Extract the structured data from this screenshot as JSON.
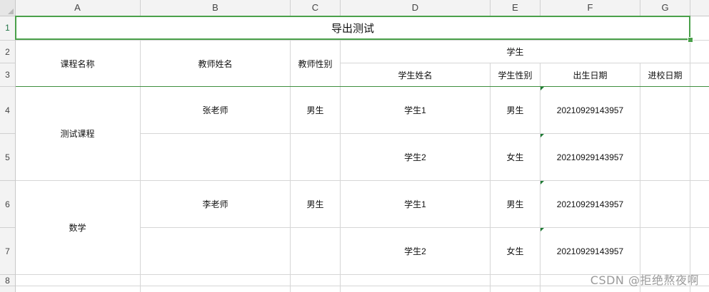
{
  "sheet": {
    "title": "导出测试",
    "columns": [
      "A",
      "B",
      "C",
      "D",
      "E",
      "F",
      "G"
    ],
    "rows": [
      "1",
      "2",
      "3",
      "4",
      "5",
      "6",
      "7",
      "8"
    ],
    "header": {
      "course_name": "课程名称",
      "teacher_name": "教师姓名",
      "teacher_gender": "教师性别",
      "student_group": "学生",
      "student_name": "学生姓名",
      "student_gender": "学生性别",
      "birth_date": "出生日期",
      "enroll_date": "进校日期"
    },
    "data": [
      {
        "course": "测试课程",
        "teacher": "张老师",
        "teacher_gender": "男生",
        "students": [
          {
            "name": "学生1",
            "gender": "男生",
            "birth": "20210929143957"
          },
          {
            "name": "学生2",
            "gender": "女生",
            "birth": "20210929143957"
          }
        ]
      },
      {
        "course": "数学",
        "teacher": "李老师",
        "teacher_gender": "男生",
        "students": [
          {
            "name": "学生1",
            "gender": "男生",
            "birth": "20210929143957"
          },
          {
            "name": "学生2",
            "gender": "女生",
            "birth": "20210929143957"
          }
        ]
      }
    ]
  },
  "watermark": "CSDN @拒绝熬夜啊",
  "colors": {
    "selection": "#4aa04a",
    "accent": "#217346",
    "gridline": "#d6d6d6",
    "indicator": "#1e7b34"
  }
}
